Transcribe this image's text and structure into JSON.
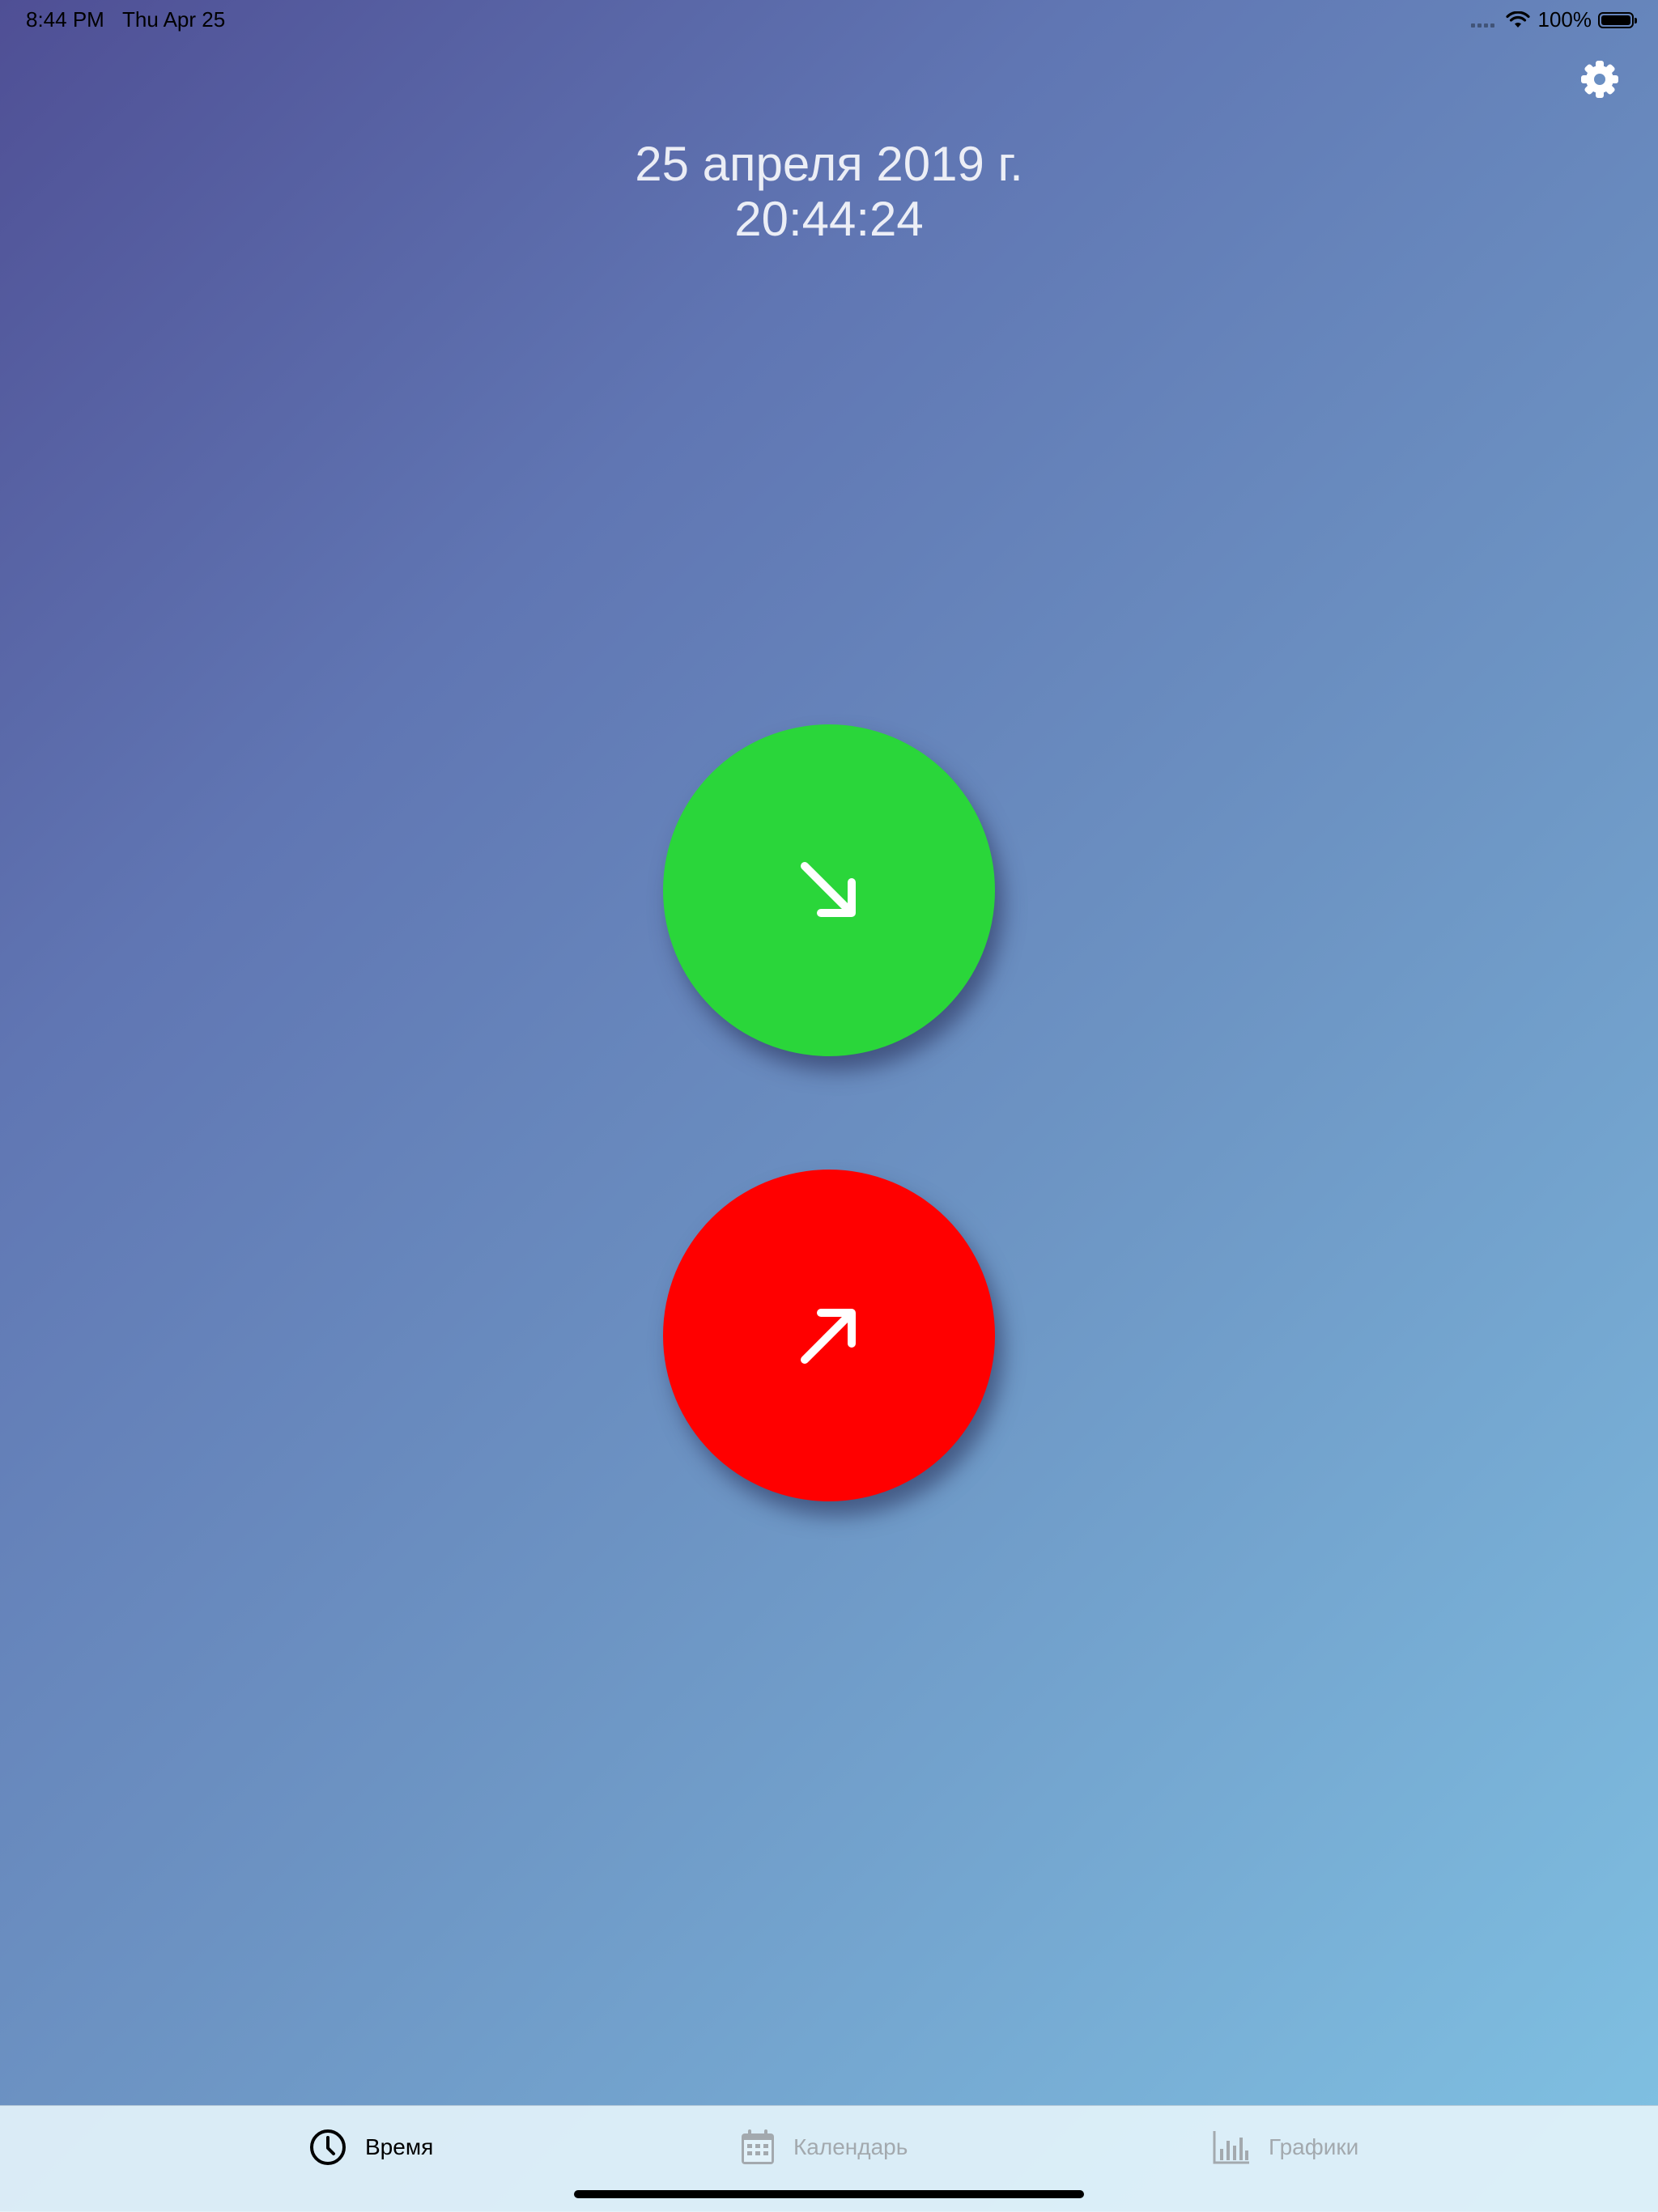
{
  "status_bar": {
    "time": "8:44 PM",
    "date": "Thu Apr 25",
    "battery": "100%"
  },
  "header": {
    "date": "25 апреля 2019 г.",
    "time": "20:44:24"
  },
  "actions": {
    "check_in": {
      "icon": "arrow-down-right-icon",
      "color": "#2ad63a"
    },
    "check_out": {
      "icon": "arrow-up-right-icon",
      "color": "#ff0000"
    }
  },
  "tab_bar": {
    "tabs": [
      {
        "label": "Время",
        "icon": "clock-icon",
        "active": true
      },
      {
        "label": "Календарь",
        "icon": "calendar-icon",
        "active": false
      },
      {
        "label": "Графики",
        "icon": "chart-icon",
        "active": false
      }
    ]
  },
  "colors": {
    "gradient_start": "#4f4f95",
    "gradient_end": "#80c2e3",
    "tab_bar_bg": "#e2f2fa",
    "tab_inactive": "#a3a9ae"
  }
}
